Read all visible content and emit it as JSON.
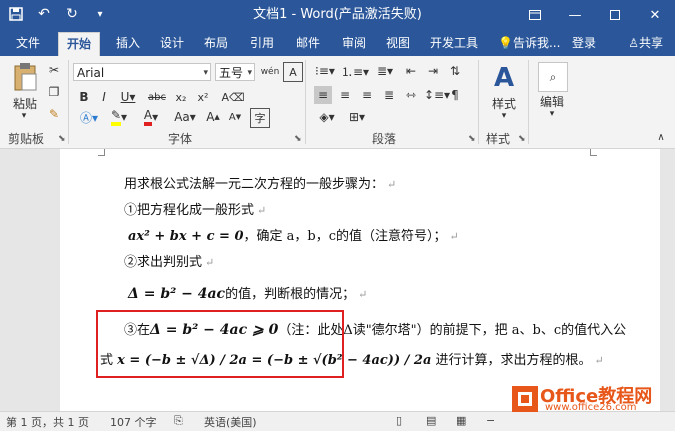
{
  "window": {
    "title": "文档1 - Word(产品激活失败)",
    "qat": {
      "save_icon": "save-icon",
      "undo_icon": "undo-icon",
      "redo_icon": "redo-icon",
      "customize_icon": "customize-icon"
    },
    "controls": {
      "ribbon_display": "ribbon-display-icon",
      "minimize": "minimize-icon",
      "maximize": "maximize-icon",
      "close": "close-icon"
    }
  },
  "tabs": [
    "文件",
    "开始",
    "插入",
    "设计",
    "布局",
    "引用",
    "邮件",
    "审阅",
    "视图",
    "开发工具"
  ],
  "active_tab": "开始",
  "tell_me": "告诉我...",
  "login": "登录",
  "share": "共享",
  "ribbon": {
    "clipboard": {
      "paste": "粘贴",
      "label": "剪贴板"
    },
    "font": {
      "name": "Arial",
      "size": "五号",
      "label": "字体"
    },
    "paragraph": {
      "label": "段落"
    },
    "styles": {
      "button": "样式",
      "label": "样式"
    },
    "editing": {
      "button": "编辑"
    }
  },
  "document": {
    "line1": "用求根公式法解一元二次方程的一般步骤为：",
    "line2": "①把方程化成一般形式",
    "line3_formula": "ax² + bx + c = 0",
    "line3_text": "，确定 a，b，c的值（注意符号）；",
    "line4": "②求出判别式",
    "line5_formula": "Δ = b² − 4ac",
    "line5_text": "的值，判断根的情况；",
    "line6_prefix": "③在",
    "line6_formula": "Δ = b² − 4ac ⩾ 0",
    "line6_text": "（注：此处Δ读\"德尔塔\"）的前提下，把 a、b、c的值代入公",
    "line7_prefix": "式",
    "line7_formula1": "x = (−b ± √Δ) / 2a = (−b ± √(b² − 4ac)) / 2a",
    "line7_text": "进行计算，求出方程的根。",
    "para_mark": "↵"
  },
  "status": {
    "page": "第 1 页，共 1 页",
    "words": "107 个字",
    "language": "英语(美国)"
  },
  "watermark": {
    "brand": "Office教程网",
    "url": "www.office26.com"
  }
}
